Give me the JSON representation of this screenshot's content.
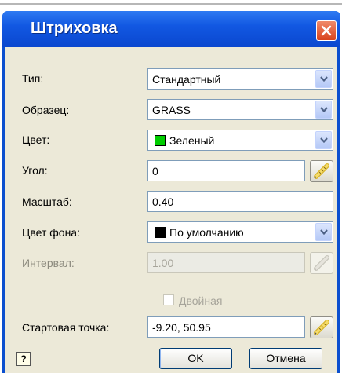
{
  "window": {
    "title": "Штриховка"
  },
  "fields": {
    "type": {
      "label": "Тип:",
      "value": "Стандартный"
    },
    "pattern": {
      "label": "Образец:",
      "value": "GRASS"
    },
    "color": {
      "label": "Цвет:",
      "value": "Зеленый",
      "swatch": "#00cc00"
    },
    "angle": {
      "label": "Угол:",
      "value": "0"
    },
    "scale": {
      "label": "Масштаб:",
      "value": "0.40"
    },
    "bg_color": {
      "label": "Цвет фона:",
      "value": "По умолчанию",
      "swatch": "#000000"
    },
    "spacing": {
      "label": "Интервал:",
      "value": "1.00",
      "disabled": true
    },
    "double": {
      "label": "Двойная",
      "checked": false,
      "disabled": true
    },
    "start_point": {
      "label": "Стартовая точка:",
      "value": "-9.20, 50.95"
    }
  },
  "buttons": {
    "ok": "OK",
    "cancel": "Отмена",
    "help": "?"
  },
  "colors": {
    "titlebar": "#0a47cf",
    "panel": "#ece9d8",
    "close": "#d9431d"
  },
  "icons": [
    "close-icon",
    "dropdown-arrow-icon",
    "pick-ruler-icon",
    "help-icon"
  ]
}
